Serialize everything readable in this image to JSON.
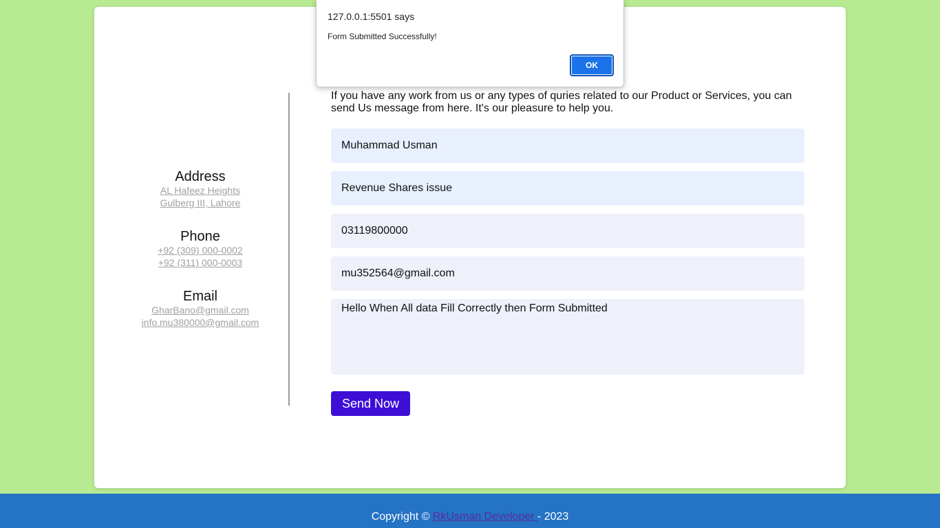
{
  "contact_info": {
    "address": {
      "title": "Address",
      "lines": [
        "AL Hafeez Heights",
        "Gulberg III, Lahore"
      ]
    },
    "phone": {
      "title": "Phone",
      "lines": [
        "+92 (309) 000-0002",
        "+92 (311) 000-0003"
      ]
    },
    "email": {
      "title": "Email",
      "lines": [
        "GharBano@gmail.com",
        "info.mu380000@gmail.com"
      ]
    }
  },
  "form": {
    "intro": "If you have any work from us or any types of quries related to our Product or Services, you can send Us message from here. It's our pleasure to help you.",
    "name_value": "Muhammad Usman",
    "subject_value": "Revenue Shares issue",
    "phone_value": "03119800000",
    "email_value": "mu352564@gmail.com",
    "message_value": "Hello When All data Fill Correctly then Form Submitted",
    "submit_label": "Send Now"
  },
  "footer": {
    "prefix": "Copyright © ",
    "link_text": "RkUsman Developer ",
    "suffix": " - 2023"
  },
  "dialog": {
    "origin": "127.0.0.1:5501 says",
    "message": "Form Submitted Successfully!",
    "ok_label": "OK"
  },
  "colors": {
    "page_background": "#b8ea92",
    "footer_background": "#2473c4",
    "submit_button": "#3d0fd6",
    "dialog_ok": "#1a73e8"
  }
}
